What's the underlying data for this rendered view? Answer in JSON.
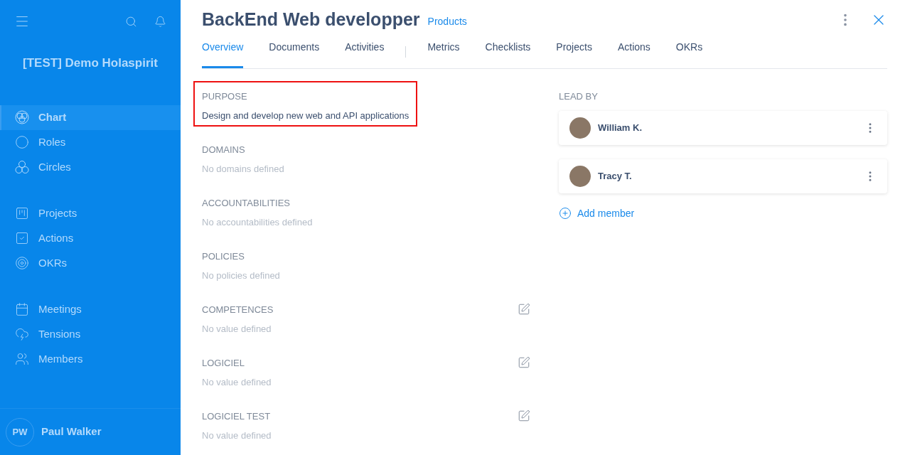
{
  "sidebar": {
    "org_name": "[TEST] Demo Holaspirit",
    "groups": [
      [
        {
          "label": "Chart",
          "selected": true
        },
        {
          "label": "Roles",
          "selected": false
        },
        {
          "label": "Circles",
          "selected": false
        }
      ],
      [
        {
          "label": "Projects",
          "selected": false
        },
        {
          "label": "Actions",
          "selected": false
        },
        {
          "label": "OKRs",
          "selected": false
        }
      ],
      [
        {
          "label": "Meetings",
          "selected": false
        },
        {
          "label": "Tensions",
          "selected": false
        },
        {
          "label": "Members",
          "selected": false
        }
      ]
    ],
    "user": {
      "initials": "PW",
      "name": "Paul Walker"
    }
  },
  "panel": {
    "title": "BackEnd Web developper",
    "circle": "Products",
    "tab_groups": [
      [
        {
          "label": "Overview",
          "selected": true
        },
        {
          "label": "Documents",
          "selected": false
        },
        {
          "label": "Activities",
          "selected": false
        }
      ],
      [
        {
          "label": "Metrics",
          "selected": false
        },
        {
          "label": "Checklists",
          "selected": false
        },
        {
          "label": "Projects",
          "selected": false
        },
        {
          "label": "Actions",
          "selected": false
        },
        {
          "label": "OKRs",
          "selected": false
        }
      ]
    ],
    "sections": [
      {
        "heading": "PURPOSE",
        "text": "Design and develop new web and API applications",
        "empty": false,
        "editable": false,
        "highlighted": true
      },
      {
        "heading": "DOMAINS",
        "text": "No domains defined",
        "empty": true,
        "editable": false,
        "highlighted": false
      },
      {
        "heading": "ACCOUNTABILITIES",
        "text": "No accountabilities defined",
        "empty": true,
        "editable": false,
        "highlighted": false
      },
      {
        "heading": "POLICIES",
        "text": "No policies defined",
        "empty": true,
        "editable": false,
        "highlighted": false
      },
      {
        "heading": "COMPETENCES",
        "text": "No value defined",
        "empty": true,
        "editable": true,
        "highlighted": false
      },
      {
        "heading": "LOGICIEL",
        "text": "No value defined",
        "empty": true,
        "editable": true,
        "highlighted": false
      },
      {
        "heading": "LOGICIEL TEST",
        "text": "No value defined",
        "empty": true,
        "editable": true,
        "highlighted": false
      }
    ],
    "lead_by": {
      "heading": "LEAD BY",
      "members": [
        {
          "name": "William K."
        },
        {
          "name": "Tracy T."
        }
      ],
      "add_label": "Add member"
    }
  }
}
